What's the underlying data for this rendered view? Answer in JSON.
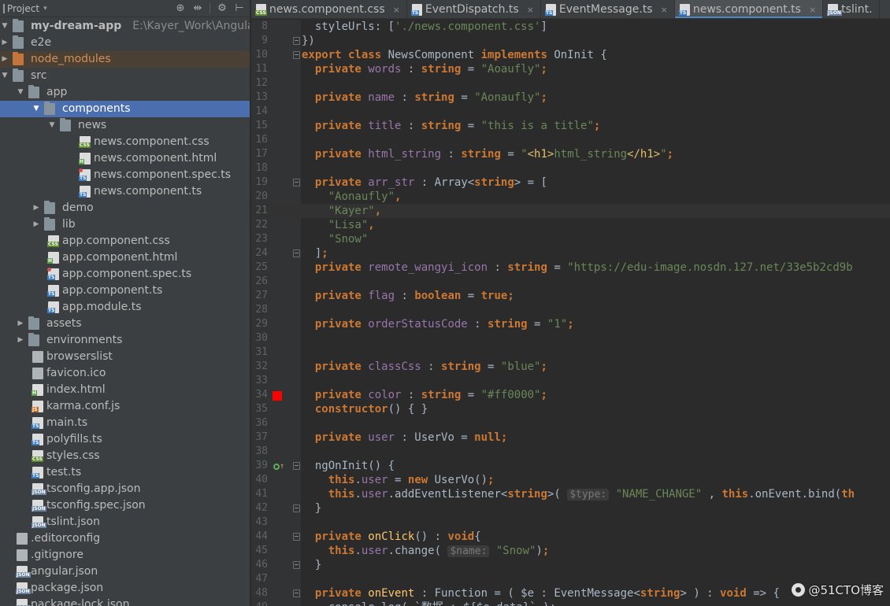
{
  "panel": {
    "title": "Project",
    "tools": [
      "target-icon",
      "collapse-icon",
      "settings-icon",
      "hide-icon"
    ]
  },
  "tree": [
    {
      "label": "my-dream-app",
      "path": "E:\\Kayer_Work\\Angular\\m",
      "depth": 0,
      "kind": "root",
      "arrow": "down"
    },
    {
      "label": "e2e",
      "depth": 0,
      "kind": "folder",
      "arrow": "right"
    },
    {
      "label": "node_modules",
      "depth": 0,
      "kind": "folder-excluded",
      "arrow": "right",
      "highlighted": true
    },
    {
      "label": "src",
      "depth": 0,
      "kind": "folder",
      "arrow": "down"
    },
    {
      "label": "app",
      "depth": 1,
      "kind": "folder",
      "arrow": "down"
    },
    {
      "label": "components",
      "depth": 2,
      "kind": "folder",
      "arrow": "down",
      "selected": true
    },
    {
      "label": "news",
      "depth": 3,
      "kind": "folder",
      "arrow": "down"
    },
    {
      "label": "news.component.css",
      "depth": 4,
      "kind": "file",
      "tag": "css"
    },
    {
      "label": "news.component.html",
      "depth": 4,
      "kind": "file",
      "tag": "h"
    },
    {
      "label": "news.component.spec.ts",
      "depth": 4,
      "kind": "file",
      "tag": "ts",
      "spec": true
    },
    {
      "label": "news.component.ts",
      "depth": 4,
      "kind": "file",
      "tag": "ts"
    },
    {
      "label": "demo",
      "depth": 2,
      "kind": "folder",
      "arrow": "right"
    },
    {
      "label": "lib",
      "depth": 2,
      "kind": "folder",
      "arrow": "right"
    },
    {
      "label": "app.component.css",
      "depth": 2,
      "kind": "file",
      "tag": "css"
    },
    {
      "label": "app.component.html",
      "depth": 2,
      "kind": "file",
      "tag": "h"
    },
    {
      "label": "app.component.spec.ts",
      "depth": 2,
      "kind": "file",
      "tag": "ts",
      "spec": true
    },
    {
      "label": "app.component.ts",
      "depth": 2,
      "kind": "file",
      "tag": "ts"
    },
    {
      "label": "app.module.ts",
      "depth": 2,
      "kind": "file",
      "tag": "ts"
    },
    {
      "label": "assets",
      "depth": 1,
      "kind": "folder",
      "arrow": "right"
    },
    {
      "label": "environments",
      "depth": 1,
      "kind": "folder",
      "arrow": "right"
    },
    {
      "label": "browserslist",
      "depth": 1,
      "kind": "file",
      "tag": ""
    },
    {
      "label": "favicon.ico",
      "depth": 1,
      "kind": "file",
      "tag": ""
    },
    {
      "label": "index.html",
      "depth": 1,
      "kind": "file",
      "tag": "h"
    },
    {
      "label": "karma.conf.js",
      "depth": 1,
      "kind": "file",
      "tag": "js"
    },
    {
      "label": "main.ts",
      "depth": 1,
      "kind": "file",
      "tag": "ts"
    },
    {
      "label": "polyfills.ts",
      "depth": 1,
      "kind": "file",
      "tag": "ts"
    },
    {
      "label": "styles.css",
      "depth": 1,
      "kind": "file",
      "tag": "css"
    },
    {
      "label": "test.ts",
      "depth": 1,
      "kind": "file",
      "tag": "ts"
    },
    {
      "label": "tsconfig.app.json",
      "depth": 1,
      "kind": "file",
      "tag": "json"
    },
    {
      "label": "tsconfig.spec.json",
      "depth": 1,
      "kind": "file",
      "tag": "json"
    },
    {
      "label": "tslint.json",
      "depth": 1,
      "kind": "file",
      "tag": "json"
    },
    {
      "label": ".editorconfig",
      "depth": 0,
      "kind": "file",
      "tag": ""
    },
    {
      "label": ".gitignore",
      "depth": 0,
      "kind": "file",
      "tag": ""
    },
    {
      "label": "angular.json",
      "depth": 0,
      "kind": "file",
      "tag": "json"
    },
    {
      "label": "package.json",
      "depth": 0,
      "kind": "file",
      "tag": "json"
    },
    {
      "label": "package-lock.json",
      "depth": 0,
      "kind": "file",
      "tag": "json"
    }
  ],
  "tabs": [
    {
      "label": "news.component.css",
      "tag": "css",
      "active": false
    },
    {
      "label": "EventDispatch.ts",
      "tag": "ts",
      "active": false
    },
    {
      "label": "EventMessage.ts",
      "tag": "ts",
      "active": false
    },
    {
      "label": "news.component.ts",
      "tag": "ts",
      "active": true
    },
    {
      "label": "tslint.",
      "tag": "json",
      "active": false
    }
  ],
  "tab_close_glyph": "×",
  "editor": {
    "current_line": 21,
    "lines": [
      {
        "n": 8,
        "toks": [
          [
            "p",
            "  styleUrls: ["
          ],
          [
            "s",
            "'./news.component.css'"
          ],
          [
            "p",
            "]"
          ]
        ]
      },
      {
        "n": 9,
        "toks": [
          [
            "p",
            "})"
          ]
        ],
        "fold": true
      },
      {
        "n": 10,
        "toks": [
          [
            "k",
            "export class "
          ],
          [
            "p",
            "NewsComponent "
          ],
          [
            "k",
            "implements "
          ],
          [
            "p",
            "OnInit {"
          ]
        ],
        "fold": true
      },
      {
        "n": 11,
        "toks": [
          [
            "k",
            "  private "
          ],
          [
            "f",
            "words"
          ],
          [
            "p",
            " : "
          ],
          [
            "k",
            "string"
          ],
          [
            "p",
            " = "
          ],
          [
            "s",
            "\"Aoaufly\""
          ],
          [
            "k",
            ";"
          ]
        ]
      },
      {
        "n": 12,
        "toks": []
      },
      {
        "n": 13,
        "toks": [
          [
            "k",
            "  private "
          ],
          [
            "f",
            "name"
          ],
          [
            "p",
            " : "
          ],
          [
            "k",
            "string"
          ],
          [
            "p",
            " = "
          ],
          [
            "s",
            "\"Aonaufly\""
          ],
          [
            "k",
            ";"
          ]
        ]
      },
      {
        "n": 14,
        "toks": []
      },
      {
        "n": 15,
        "toks": [
          [
            "k",
            "  private "
          ],
          [
            "f",
            "title"
          ],
          [
            "p",
            " : "
          ],
          [
            "k",
            "string"
          ],
          [
            "p",
            " = "
          ],
          [
            "s",
            "\"this is a title\""
          ],
          [
            "k",
            ";"
          ]
        ]
      },
      {
        "n": 16,
        "toks": []
      },
      {
        "n": 17,
        "toks": [
          [
            "k",
            "  private "
          ],
          [
            "f",
            "html_string"
          ],
          [
            "p",
            " : "
          ],
          [
            "k",
            "string"
          ],
          [
            "p",
            " = "
          ],
          [
            "s",
            "\""
          ],
          [
            "t",
            "<h1>"
          ],
          [
            "s",
            "html_string"
          ],
          [
            "t",
            "</h1>"
          ],
          [
            "s",
            "\""
          ],
          [
            "k",
            ";"
          ]
        ]
      },
      {
        "n": 18,
        "toks": []
      },
      {
        "n": 19,
        "toks": [
          [
            "k",
            "  private "
          ],
          [
            "f",
            "arr_str"
          ],
          [
            "p",
            " : Array<"
          ],
          [
            "k",
            "string"
          ],
          [
            "p",
            "> = ["
          ]
        ],
        "fold": true
      },
      {
        "n": 20,
        "toks": [
          [
            "s",
            "    \"Aonaufly\""
          ],
          [
            "k",
            ","
          ]
        ]
      },
      {
        "n": 21,
        "toks": [
          [
            "s",
            "    \"Kayer\""
          ],
          [
            "k",
            ","
          ]
        ]
      },
      {
        "n": 22,
        "toks": [
          [
            "s",
            "    \"Lisa\""
          ],
          [
            "k",
            ","
          ]
        ]
      },
      {
        "n": 23,
        "toks": [
          [
            "s",
            "    \"Snow\""
          ]
        ]
      },
      {
        "n": 24,
        "toks": [
          [
            "p",
            "  ]"
          ],
          [
            "k",
            ";"
          ]
        ],
        "fold": true
      },
      {
        "n": 25,
        "toks": [
          [
            "k",
            "  private "
          ],
          [
            "f",
            "remote_wangyi_icon"
          ],
          [
            "p",
            " : "
          ],
          [
            "k",
            "string"
          ],
          [
            "p",
            " = "
          ],
          [
            "s",
            "\"https://edu-image.nosdn.127.net/33e5b2cd9b"
          ]
        ]
      },
      {
        "n": 26,
        "toks": []
      },
      {
        "n": 27,
        "toks": [
          [
            "k",
            "  private "
          ],
          [
            "f",
            "flag"
          ],
          [
            "p",
            " : "
          ],
          [
            "k",
            "boolean"
          ],
          [
            "p",
            " = "
          ],
          [
            "k",
            "true;"
          ]
        ]
      },
      {
        "n": 28,
        "toks": []
      },
      {
        "n": 29,
        "toks": [
          [
            "k",
            "  private "
          ],
          [
            "f",
            "orderStatusCode"
          ],
          [
            "p",
            " : "
          ],
          [
            "k",
            "string"
          ],
          [
            "p",
            " = "
          ],
          [
            "s",
            "\"1\""
          ],
          [
            "k",
            ";"
          ]
        ]
      },
      {
        "n": 30,
        "toks": []
      },
      {
        "n": 31,
        "toks": []
      },
      {
        "n": 32,
        "toks": [
          [
            "k",
            "  private "
          ],
          [
            "f",
            "classCss"
          ],
          [
            "p",
            " : "
          ],
          [
            "k",
            "string"
          ],
          [
            "p",
            " = "
          ],
          [
            "s",
            "\"blue\""
          ],
          [
            "k",
            ";"
          ]
        ]
      },
      {
        "n": 33,
        "toks": []
      },
      {
        "n": 34,
        "toks": [
          [
            "k",
            "  private "
          ],
          [
            "f",
            "color"
          ],
          [
            "p",
            " : "
          ],
          [
            "k",
            "string"
          ],
          [
            "p",
            " = "
          ],
          [
            "s",
            "\"#ff0000\""
          ],
          [
            "k",
            ";"
          ]
        ],
        "marker": "color",
        "marker_color": "#ff0000"
      },
      {
        "n": 35,
        "toks": [
          [
            "k",
            "  constructor"
          ],
          [
            "p",
            "() { }"
          ]
        ]
      },
      {
        "n": 36,
        "toks": []
      },
      {
        "n": 37,
        "toks": [
          [
            "k",
            "  private "
          ],
          [
            "f",
            "user"
          ],
          [
            "p",
            " : UserVo = "
          ],
          [
            "k",
            "null;"
          ]
        ]
      },
      {
        "n": 38,
        "toks": []
      },
      {
        "n": 39,
        "toks": [
          [
            "p",
            "  ngOnInit() {"
          ]
        ],
        "marker": "impl",
        "fold": true
      },
      {
        "n": 40,
        "toks": [
          [
            "k",
            "    this"
          ],
          [
            "p",
            "."
          ],
          [
            "f",
            "user"
          ],
          [
            "p",
            " = "
          ],
          [
            "k",
            "new "
          ],
          [
            "p",
            "UserVo()"
          ],
          [
            "k",
            ";"
          ]
        ]
      },
      {
        "n": 41,
        "toks": [
          [
            "k",
            "    this"
          ],
          [
            "p",
            "."
          ],
          [
            "f",
            "user"
          ],
          [
            "p",
            ".addEventListener<"
          ],
          [
            "k",
            "string"
          ],
          [
            "p",
            ">( "
          ],
          [
            "h",
            "$type:"
          ],
          [
            "s",
            " \"NAME_CHANGE\""
          ],
          [
            "p",
            " , "
          ],
          [
            "k",
            "this"
          ],
          [
            "p",
            ".onEvent.bind("
          ],
          [
            "k",
            "th"
          ]
        ]
      },
      {
        "n": 42,
        "toks": [
          [
            "p",
            "  }"
          ]
        ],
        "fold": true
      },
      {
        "n": 43,
        "toks": []
      },
      {
        "n": 44,
        "toks": [
          [
            "k",
            "  private "
          ],
          [
            "fn",
            "onClick"
          ],
          [
            "p",
            "() : "
          ],
          [
            "k",
            "void"
          ],
          [
            "p",
            "{"
          ]
        ],
        "fold": true
      },
      {
        "n": 45,
        "toks": [
          [
            "k",
            "    this"
          ],
          [
            "p",
            "."
          ],
          [
            "f",
            "user"
          ],
          [
            "p",
            ".change( "
          ],
          [
            "h",
            "$name:"
          ],
          [
            "s",
            " \"Snow\""
          ],
          [
            "p",
            ")"
          ],
          [
            "k",
            ";"
          ]
        ]
      },
      {
        "n": 46,
        "toks": [
          [
            "p",
            "  }"
          ]
        ],
        "fold": true
      },
      {
        "n": 47,
        "toks": []
      },
      {
        "n": 48,
        "toks": [
          [
            "k",
            "  private "
          ],
          [
            "fn",
            "onEvent"
          ],
          [
            "p",
            " : Function = ( $e : EventMessage<"
          ],
          [
            "k",
            "string"
          ],
          [
            "p",
            "> ) : "
          ],
          [
            "k",
            "void"
          ],
          [
            "p",
            " => {"
          ]
        ],
        "fold": true
      },
      {
        "n": 49,
        "toks": [
          [
            "p",
            "    console.log( `数据 : ${$e.data}` );"
          ]
        ]
      }
    ]
  },
  "watermark": "@51CTO博客"
}
